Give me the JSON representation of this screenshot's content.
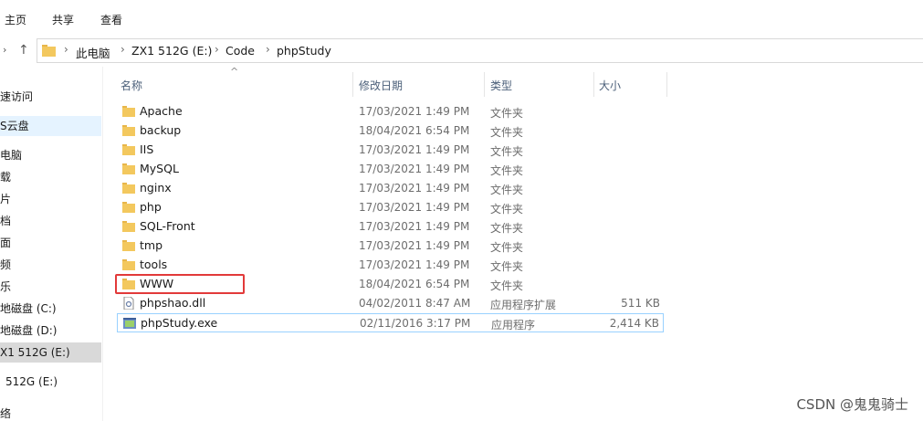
{
  "ribbon": {
    "tabs": [
      "主页",
      "共享",
      "查看"
    ]
  },
  "nav": {
    "up_arrow": "↑",
    "breadcrumb": [
      "此电脑",
      "ZX1 512G (E:)",
      "Code",
      "phpStudy"
    ]
  },
  "sidebar": {
    "items": [
      {
        "label": "速访问",
        "state": "normal"
      },
      {
        "label": "S云盘",
        "state": "hover"
      },
      {
        "label": "电脑",
        "state": "normal"
      },
      {
        "label": "载",
        "state": "normal"
      },
      {
        "label": "片",
        "state": "normal"
      },
      {
        "label": "档",
        "state": "normal"
      },
      {
        "label": "面",
        "state": "normal"
      },
      {
        "label": "频",
        "state": "normal"
      },
      {
        "label": "乐",
        "state": "normal"
      },
      {
        "label": "地磁盘 (C:)",
        "state": "normal"
      },
      {
        "label": "地磁盘 (D:)",
        "state": "normal"
      },
      {
        "label": "X1 512G (E:)",
        "state": "selected"
      },
      {
        "label": "512G (E:)",
        "state": "normal"
      },
      {
        "label": "络",
        "state": "normal"
      }
    ]
  },
  "columns": {
    "name": "名称",
    "date": "修改日期",
    "type": "类型",
    "size": "大小"
  },
  "files": [
    {
      "name": "Apache",
      "date": "17/03/2021 1:49 PM",
      "type": "文件夹",
      "size": "",
      "icon": "folder-icon"
    },
    {
      "name": "backup",
      "date": "18/04/2021 6:54 PM",
      "type": "文件夹",
      "size": "",
      "icon": "folder-icon"
    },
    {
      "name": "IIS",
      "date": "17/03/2021 1:49 PM",
      "type": "文件夹",
      "size": "",
      "icon": "folder-icon"
    },
    {
      "name": "MySQL",
      "date": "17/03/2021 1:49 PM",
      "type": "文件夹",
      "size": "",
      "icon": "folder-icon"
    },
    {
      "name": "nginx",
      "date": "17/03/2021 1:49 PM",
      "type": "文件夹",
      "size": "",
      "icon": "folder-icon"
    },
    {
      "name": "php",
      "date": "17/03/2021 1:49 PM",
      "type": "文件夹",
      "size": "",
      "icon": "folder-icon"
    },
    {
      "name": "SQL-Front",
      "date": "17/03/2021 1:49 PM",
      "type": "文件夹",
      "size": "",
      "icon": "folder-icon"
    },
    {
      "name": "tmp",
      "date": "17/03/2021 1:49 PM",
      "type": "文件夹",
      "size": "",
      "icon": "folder-icon"
    },
    {
      "name": "tools",
      "date": "17/03/2021 1:49 PM",
      "type": "文件夹",
      "size": "",
      "icon": "folder-icon"
    },
    {
      "name": "WWW",
      "date": "18/04/2021 6:54 PM",
      "type": "文件夹",
      "size": "",
      "icon": "folder-icon"
    },
    {
      "name": "phpshao.dll",
      "date": "04/02/2011 8:47 AM",
      "type": "应用程序扩展",
      "size": "511 KB",
      "icon": "dll-file-icon"
    },
    {
      "name": "phpStudy.exe",
      "date": "02/11/2016 3:17 PM",
      "type": "应用程序",
      "size": "2,414 KB",
      "icon": "exe-file-icon"
    }
  ],
  "watermark": "CSDN @鬼鬼骑士",
  "colors": {
    "folder": "#f0c25c",
    "highlight": "#e23a3a",
    "selection_border": "#99d1ff",
    "sidebar_selected": "#d9d9d9"
  }
}
